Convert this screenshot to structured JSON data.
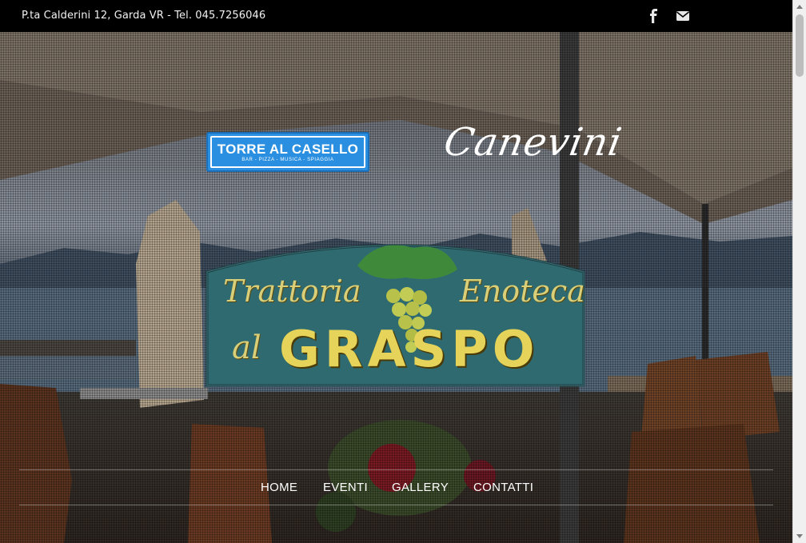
{
  "topbar": {
    "address": "P.ta Calderini 12, Garda VR - Tel. 045.7256046",
    "facebook_icon": "facebook-icon",
    "email_icon": "envelope-icon"
  },
  "logos": {
    "torre_title": "TORRE AL CASELLO",
    "torre_subtitle": "BAR - PIZZA - MUSICA - SPIAGGIA",
    "canevini": "Canevini",
    "sign_word1": "Trattoria",
    "sign_word2": "Enoteca",
    "sign_word3": "al",
    "sign_word4": "GRASPO"
  },
  "nav": {
    "items": [
      "HOME",
      "EVENTI",
      "GALLERY",
      "CONTATTI"
    ]
  },
  "colors": {
    "topbar_bg": "#000000",
    "torre_blue": "#2a8fe0",
    "sign_teal": "#2f6a70",
    "sign_gold": "#d9cf78"
  }
}
